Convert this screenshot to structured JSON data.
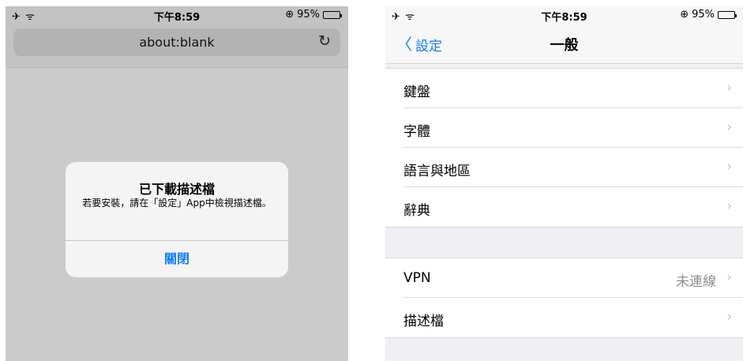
{
  "left_screen": {
    "status": {
      "left_icons": "✈ ᯤ",
      "time": "下午8:59",
      "lock_icon": "⊕",
      "battery": "95%"
    },
    "address_bar": {
      "url": "about:blank",
      "reload_icon": "↻"
    },
    "alert": {
      "title": "已下載描述檔",
      "message": "若要安裝，請在「設定」App中檢視描述檔。",
      "button": "關閉"
    }
  },
  "right_screen": {
    "status": {
      "left_icons": "✈ ᯤ",
      "time": "下午8:59",
      "lock_icon": "⊕",
      "battery": "95%"
    },
    "navbar": {
      "back_chevron": "〈",
      "back_label": "設定",
      "title": "一般"
    },
    "group1": [
      {
        "label": "鍵盤",
        "chevron": "›"
      },
      {
        "label": "字體",
        "chevron": "›"
      },
      {
        "label": "語言與地區",
        "chevron": "›"
      },
      {
        "label": "辭典",
        "chevron": "›"
      }
    ],
    "group2": [
      {
        "label": "VPN",
        "value": "未連線",
        "chevron": "›"
      },
      {
        "label": "描述檔",
        "chevron": "›"
      }
    ]
  },
  "colors": {
    "accent": "#147efb",
    "left_bg": "#cbcbcb",
    "right_bg": "#efeff4"
  }
}
